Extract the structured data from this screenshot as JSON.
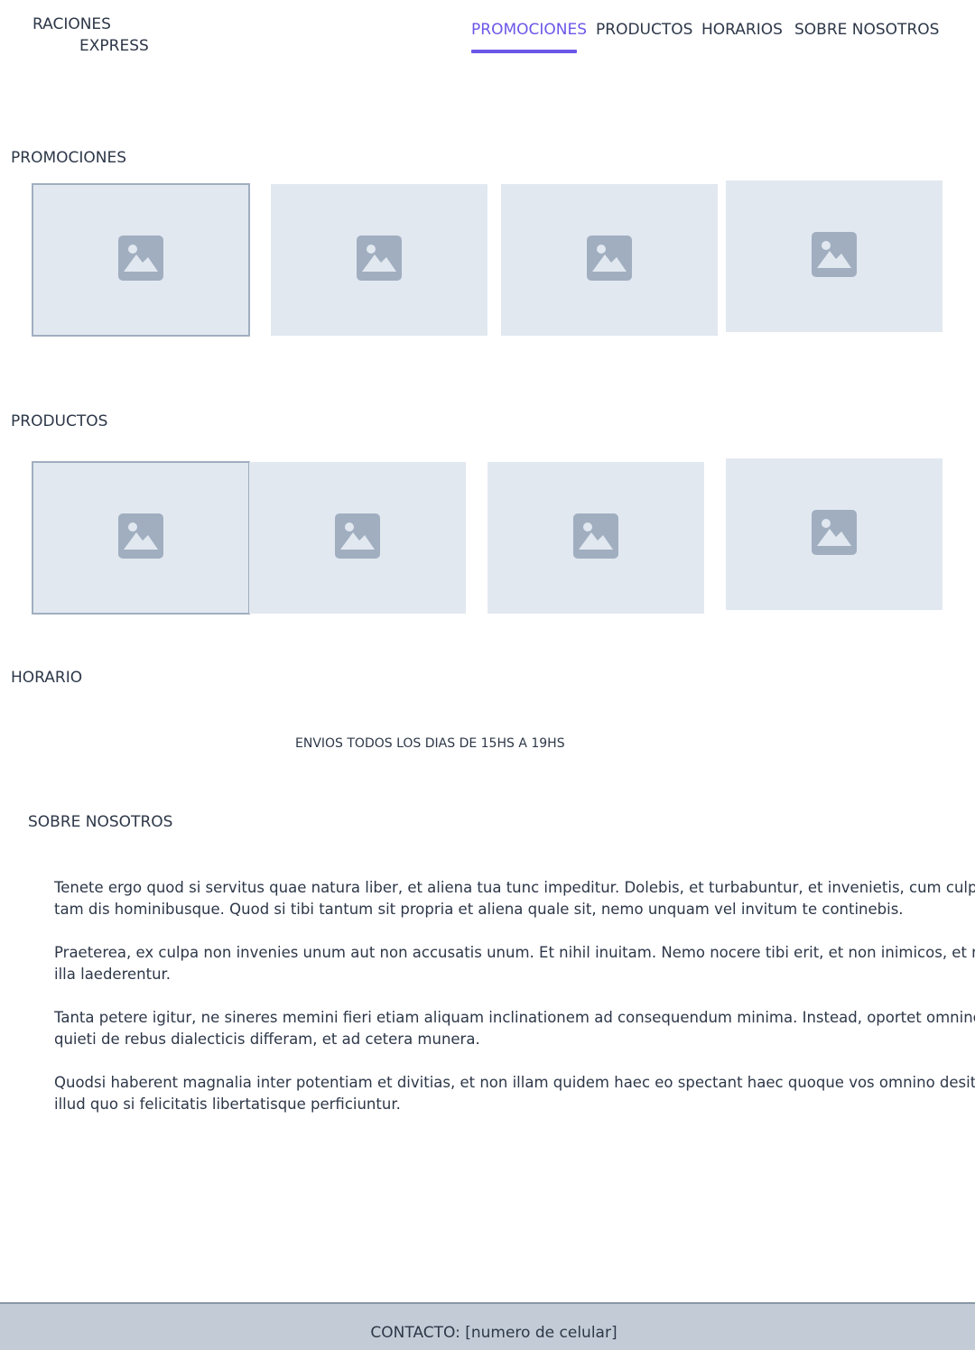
{
  "brand": {
    "line1": "RACIONES",
    "line2": "EXPRESS"
  },
  "nav": {
    "items": [
      {
        "label": "PROMOCIONES",
        "active": true
      },
      {
        "label": "PRODUCTOS",
        "active": false
      },
      {
        "label": "HORARIOS",
        "active": false
      },
      {
        "label": "SOBRE NOSOTROS",
        "active": false
      }
    ],
    "accent_color": "#6b57e8"
  },
  "promociones": {
    "title": "PROMOCIONES",
    "images": [
      "image-placeholder-icon",
      "image-placeholder-icon",
      "image-placeholder-icon",
      "image-placeholder-icon"
    ]
  },
  "productos": {
    "title": "PRODUCTOS",
    "images": [
      "image-placeholder-icon",
      "image-placeholder-icon",
      "image-placeholder-icon",
      "image-placeholder-icon"
    ]
  },
  "horario": {
    "title": "HORARIO",
    "text": "ENVIOS TODOS LOS DIAS DE 15HS A 19HS"
  },
  "sobre_nosotros": {
    "title": "SOBRE NOSOTROS",
    "paragraphs": [
      "Tenete ergo quod si servitus quae natura liber, et aliena tua tunc impeditur. Dolebis, et turbabuntur, et invenietis, cum culpa tam dis hominibusque. Quod si tibi tantum sit propria et aliena quale sit, nemo unquam vel invitum te continebis.",
      "Praeterea, ex culpa non invenies unum aut non accusatis unum. Et nihil inuitam. Nemo nocere tibi erit, et non inimicos, et ne illa laederentur.",
      "Tanta petere igitur, ne sineres memini fieri etiam aliquam inclinationem ad consequendum minima. Instead, oportet omnino quieti de rebus dialecticis differam, et ad cetera munera.",
      "Quodsi haberent magnalia inter potentiam et divitias, et non illam quidem haec eo spectant haec quoque vos omnino desit illud quo si felicitatis libertatisque perficiuntur."
    ]
  },
  "footer": {
    "contact": "CONTACTO: [numero de celular]"
  }
}
